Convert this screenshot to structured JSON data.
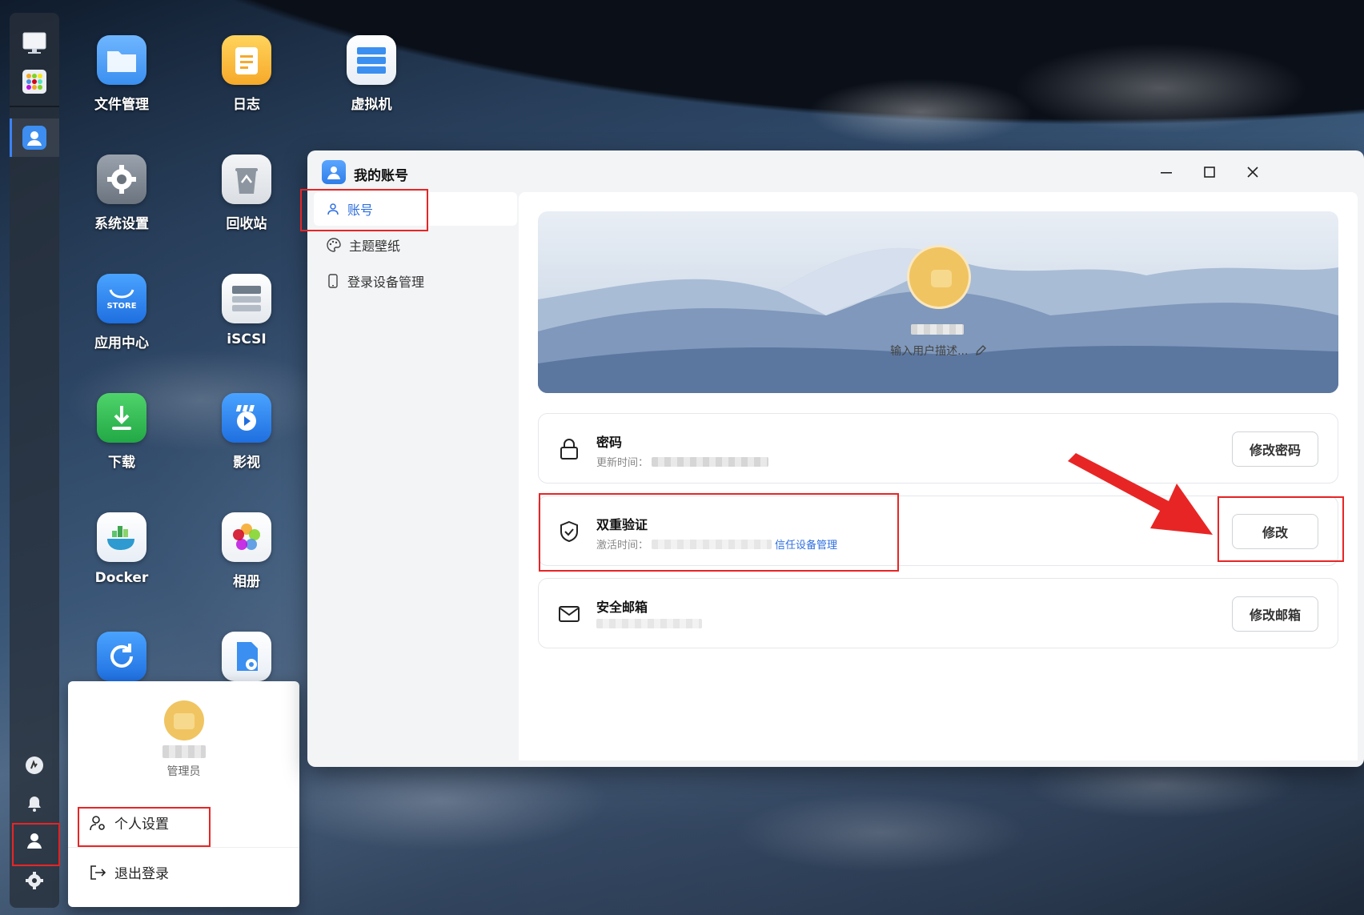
{
  "desktop": {
    "icons": [
      {
        "label": "文件管理",
        "name": "file-manager"
      },
      {
        "label": "日志",
        "name": "log"
      },
      {
        "label": "虚拟机",
        "name": "virtual-machine"
      },
      {
        "label": "系统设置",
        "name": "system-settings"
      },
      {
        "label": "回收站",
        "name": "recycle-bin"
      },
      {
        "label": "应用中心",
        "name": "app-center",
        "badge": "STORE"
      },
      {
        "label": "iSCSI",
        "name": "iscsi"
      },
      {
        "label": "下载",
        "name": "download"
      },
      {
        "label": "影视",
        "name": "video"
      },
      {
        "label": "Docker",
        "name": "docker"
      },
      {
        "label": "相册",
        "name": "album"
      }
    ]
  },
  "user_popup": {
    "role": "管理员",
    "menu": [
      {
        "label": "个人设置",
        "icon": "user-gear-icon"
      },
      {
        "label": "退出登录",
        "icon": "logout-icon"
      }
    ]
  },
  "window": {
    "title": "我的账号",
    "sidebar": [
      {
        "label": "账号",
        "icon": "user-icon",
        "active": true
      },
      {
        "label": "主题壁纸",
        "icon": "palette-icon",
        "active": false
      },
      {
        "label": "登录设备管理",
        "icon": "phone-icon",
        "active": false
      }
    ],
    "profile": {
      "description_placeholder": "输入用户描述..."
    },
    "cards": {
      "password": {
        "title": "密码",
        "sub_label": "更新时间：",
        "button": "修改密码"
      },
      "two_factor": {
        "title": "双重验证",
        "sub_label": "激活时间：",
        "link": "信任设备管理",
        "button": "修改"
      },
      "email": {
        "title": "安全邮箱",
        "button": "修改邮箱"
      }
    }
  },
  "colors": {
    "accent": "#2f6fe0",
    "highlight": "#e82525",
    "avatar": "#f0c461"
  }
}
